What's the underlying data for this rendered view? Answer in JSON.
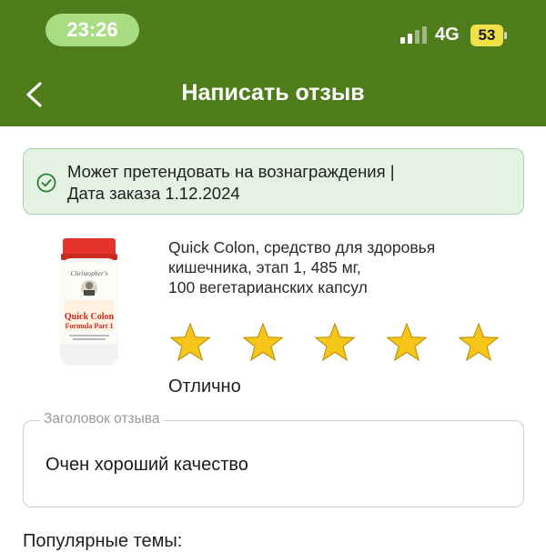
{
  "status_bar": {
    "time": "23:26",
    "network": "4G",
    "battery": "53"
  },
  "header": {
    "title": "Написать отзыв",
    "back_icon": "chevron-left-icon"
  },
  "eligibility_banner": {
    "icon": "check-circle-icon",
    "line1": "Может претендовать на вознаграждения  |",
    "line2": "Дата заказа 1.12.2024"
  },
  "product": {
    "name_lines": [
      "Quick Colon, средство для здоровья",
      "кишечника, этап 1, 485 мг,",
      "100 вегетарианских капсул"
    ],
    "bottle_brand": "Christopher's",
    "bottle_name1": "Quick Colon",
    "bottle_name2": "Formula Part 1"
  },
  "rating": {
    "value": 5,
    "max": 5,
    "label": "Отлично",
    "star_color": "#f5c518"
  },
  "review_title_field": {
    "label": "Заголовок отзыва",
    "value": "Очен хороший качество"
  },
  "popular_topics": {
    "heading": "Популярные темы:"
  },
  "colors": {
    "header_bg": "#4f7d1c",
    "banner_bg": "#e4f2e4",
    "banner_border": "#a9d3a9",
    "check": "#2e7d32"
  }
}
